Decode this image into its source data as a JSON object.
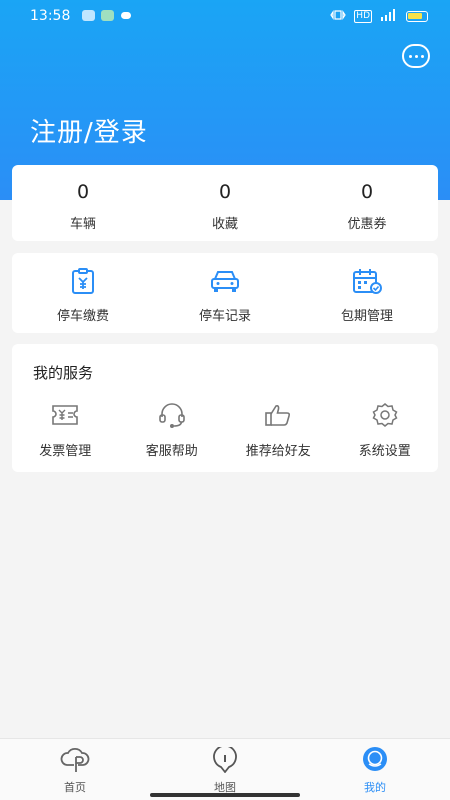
{
  "status_bar": {
    "time": "13:58",
    "hd": "HD"
  },
  "header": {
    "login_title": "注册/登录"
  },
  "stats": [
    {
      "value": "0",
      "label": "车辆"
    },
    {
      "value": "0",
      "label": "收藏"
    },
    {
      "value": "0",
      "label": "优惠券"
    }
  ],
  "quick_actions": [
    {
      "label": "停车缴费",
      "icon": "payment-icon"
    },
    {
      "label": "停车记录",
      "icon": "car-icon"
    },
    {
      "label": "包期管理",
      "icon": "calendar-icon"
    }
  ],
  "services": {
    "title": "我的服务",
    "items": [
      {
        "label": "发票管理",
        "icon": "invoice-icon"
      },
      {
        "label": "客服帮助",
        "icon": "headset-icon"
      },
      {
        "label": "推荐给好友",
        "icon": "thumbs-up-icon"
      },
      {
        "label": "系统设置",
        "icon": "gear-icon"
      }
    ]
  },
  "tabbar": [
    {
      "label": "首页",
      "icon": "home-logo-icon",
      "active": false
    },
    {
      "label": "地图",
      "icon": "map-pin-icon",
      "active": false
    },
    {
      "label": "我的",
      "icon": "profile-icon",
      "active": true
    }
  ],
  "colors": {
    "brand_blue": "#2b8ef6",
    "header_top": "#1aa5f5"
  }
}
